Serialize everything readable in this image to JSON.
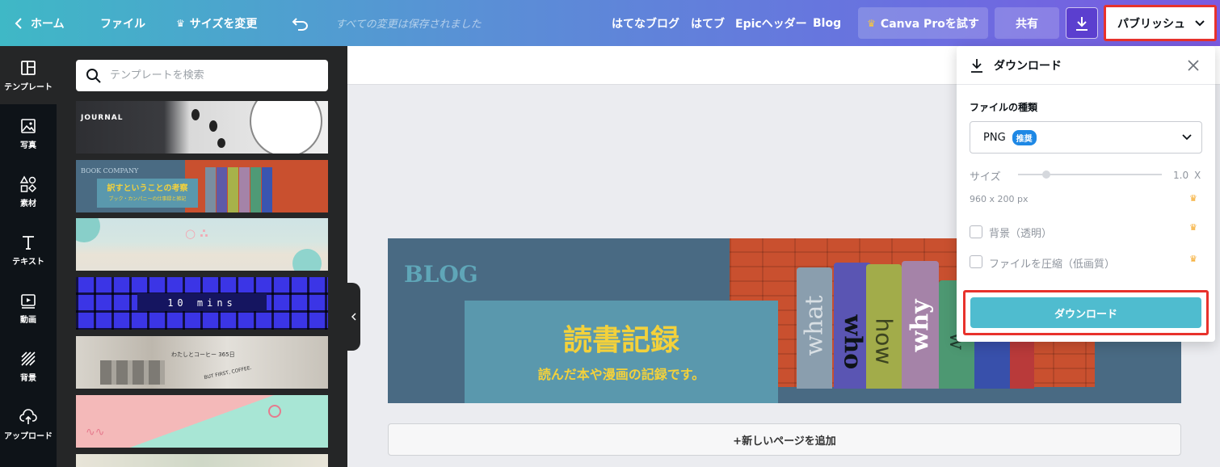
{
  "header": {
    "home": "ホーム",
    "file": "ファイル",
    "resize": "サイズを変更",
    "saved_status": "すべての変更は保存されました",
    "links": [
      "はてなブログ",
      "はてブ",
      "Epicヘッダー",
      "Blog"
    ],
    "try_pro": "Canva Proを試す",
    "share": "共有",
    "publish": "パブリッシュ"
  },
  "nav": {
    "items": [
      {
        "label": "テンプレート",
        "icon": "template-icon"
      },
      {
        "label": "写真",
        "icon": "photo-icon"
      },
      {
        "label": "素材",
        "icon": "elements-icon"
      },
      {
        "label": "テキスト",
        "icon": "text-icon"
      },
      {
        "label": "動画",
        "icon": "video-icon"
      },
      {
        "label": "背景",
        "icon": "background-icon"
      },
      {
        "label": "アップロード",
        "icon": "upload-icon"
      }
    ]
  },
  "panel": {
    "search_placeholder": "テンプレートを検索",
    "thumbnails": {
      "journal": "JOURNAL",
      "book_company": "BOOK COMPANY",
      "book_title": "訳すということの考察",
      "book_sub": "ブック・カンパニーの仕事録と雑記",
      "ten_mins": "10 mins",
      "record": "わたしとコーヒー 365日",
      "coffee": "BUT FIRST, COFFEE."
    }
  },
  "design": {
    "blog_label": "BLOG",
    "title": "読書記録",
    "subtitle": "読んだ本や漫画の記録です。",
    "spines": [
      "what",
      "who",
      "how",
      "why",
      "w"
    ]
  },
  "add_page": "+新しいページを追加",
  "download_panel": {
    "title": "ダウンロード",
    "file_type_label": "ファイルの種類",
    "file_type_value": "PNG",
    "recommended_badge": "推奨",
    "size_label": "サイズ",
    "size_value": "1.0",
    "size_unit": "X",
    "size_slider_value": 1.0,
    "dimensions": "960 x 200 px",
    "transparent_bg": "背景（透明）",
    "compress": "ファイルを圧縮（低画質）",
    "download_button": "ダウンロード"
  },
  "colors": {
    "accent": "#4fbccf",
    "highlight_border": "#e8322c",
    "design_bg": "#496a83",
    "title_yellow": "#f3d13b"
  }
}
